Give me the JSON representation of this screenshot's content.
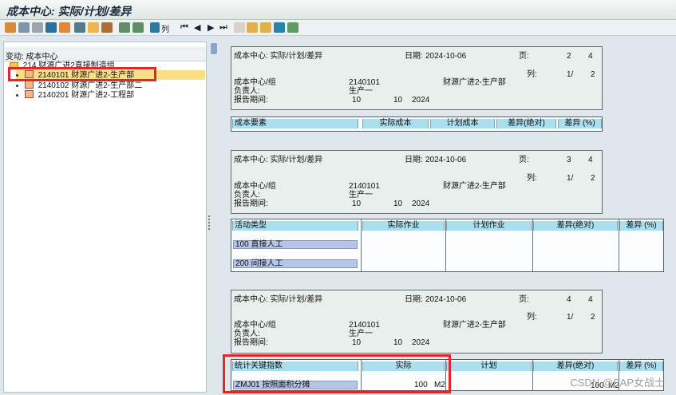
{
  "window": {
    "title": "成本中心: 实际/计划/差异"
  },
  "toolbar": {
    "column_label": "列"
  },
  "left_panel": {
    "header": "变动: 成本中心",
    "tree": [
      {
        "label": "214 财源广进2直接制造组",
        "level": 0,
        "type": "folder"
      },
      {
        "label": "2140101 财源广进2-生产部",
        "level": 1,
        "type": "cost-center",
        "selected": true
      },
      {
        "label": "2140102 财源广进2-生产部二",
        "level": 1,
        "type": "cost-center"
      },
      {
        "label": "2140201 财源广进2-工程部",
        "level": 1,
        "type": "cost-center"
      }
    ]
  },
  "reports": [
    {
      "title": "成本中心: 实际/计划/差异",
      "date_label": "日期:",
      "date": "2024-10-06",
      "page_label": "页:",
      "page": "2",
      "page_total": "4",
      "column_label": "列:",
      "column": "1/",
      "column_total": "2",
      "cost_center_label": "成本中心/组",
      "cost_center": "2140101",
      "cost_center_name": "财源广进2-生产部",
      "responsible_label": "负责人:",
      "responsible": "生产一",
      "period_label": "报告期间:",
      "period_from": "10",
      "period_to": "10",
      "year": "2024",
      "table_headers": [
        "成本要素",
        "实际成本",
        "计划成本",
        "差异(绝对)",
        "差异 (%)"
      ],
      "rows": []
    },
    {
      "title": "成本中心: 实际/计划/差异",
      "date_label": "日期:",
      "date": "2024-10-06",
      "page_label": "页:",
      "page": "3",
      "page_total": "4",
      "column_label": "列:",
      "column": "1/",
      "column_total": "2",
      "cost_center_label": "成本中心/组",
      "cost_center": "2140101",
      "cost_center_name": "财源广进2-生产部",
      "responsible_label": "负责人:",
      "responsible": "生产一",
      "period_label": "报告期间:",
      "period_from": "10",
      "period_to": "10",
      "year": "2024",
      "table_headers": [
        "活动类型",
        "实际作业",
        "计划作业",
        "差异(绝对)",
        "差异 (%)"
      ],
      "rows": [
        {
          "label": "100  直接人工"
        },
        {
          "label": "200  间接人工"
        }
      ]
    },
    {
      "title": "成本中心: 实际/计划/差异",
      "date_label": "日期:",
      "date": "2024-10-06",
      "page_label": "页:",
      "page": "4",
      "page_total": "4",
      "column_label": "列:",
      "column": "1/",
      "column_total": "2",
      "cost_center_label": "成本中心/组",
      "cost_center": "2140101",
      "cost_center_name": "财源广进2-生产部",
      "responsible_label": "负责人:",
      "responsible": "生产一",
      "period_label": "报告期间:",
      "period_from": "10",
      "period_to": "10",
      "year": "2024",
      "table_headers": [
        "统计关键指数",
        "实际",
        "计划",
        "差异(绝对)",
        "差异 (%)"
      ],
      "rows": [
        {
          "label": "ZMJ01  按照面积分摊",
          "actual": "100",
          "actual_unit": "M2",
          "variance": "100",
          "variance_unit": "M2"
        }
      ]
    }
  ],
  "watermark": {
    "text": "CSDN @SAP女战士"
  }
}
